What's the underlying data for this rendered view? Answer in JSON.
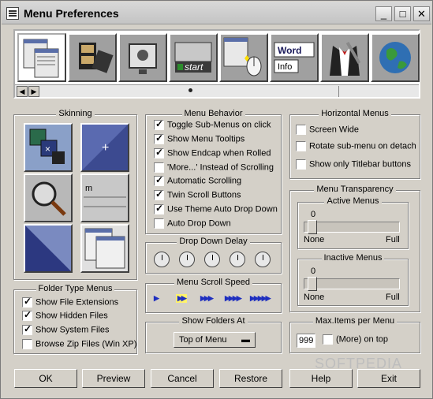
{
  "window": {
    "title": "Menu Preferences",
    "minimize": "_",
    "maximize": "□",
    "close": "✕"
  },
  "strip": {
    "tiles": [
      {
        "name": "menu-list-icon"
      },
      {
        "name": "film-icon"
      },
      {
        "name": "screen-icon"
      },
      {
        "name": "start-menu-icon",
        "label": "start"
      },
      {
        "name": "mouse-click-icon"
      },
      {
        "name": "word-info-icon",
        "label1": "Word",
        "label2": "Info"
      },
      {
        "name": "tuxedo-icon"
      },
      {
        "name": "globe-icon"
      }
    ],
    "scroll_left": "◀",
    "scroll_right": "▶"
  },
  "skinning": {
    "title": "Skinning"
  },
  "folder_types": {
    "title": "Folder Type Menus",
    "items": [
      {
        "label": "Show File Extensions",
        "checked": true
      },
      {
        "label": "Show Hidden Files",
        "checked": true
      },
      {
        "label": "Show System Files",
        "checked": true
      },
      {
        "label": "Browse Zip Files (Win XP)",
        "checked": false
      }
    ]
  },
  "menu_behavior": {
    "title": "Menu Behavior",
    "items": [
      {
        "label": "Toggle Sub-Menus on click",
        "checked": true
      },
      {
        "label": "Show Menu Tooltips",
        "checked": true
      },
      {
        "label": "Show Endcap when Rolled",
        "checked": true
      },
      {
        "label": "'More...' Instead of Scrolling",
        "checked": false
      },
      {
        "label": "Automatic Scrolling",
        "checked": true
      },
      {
        "label": "Twin Scroll Buttons",
        "checked": true
      },
      {
        "label": "Use Theme Auto Drop Down",
        "checked": true
      },
      {
        "label": "Auto Drop Down",
        "checked": false
      }
    ]
  },
  "drop_down_delay": {
    "title": "Drop Down Delay"
  },
  "menu_scroll_speed": {
    "title": "Menu Scroll Speed",
    "arrows": [
      "▶",
      "▶▶",
      "▶▶▶",
      "▶▶▶▶",
      "▶▶▶▶▶"
    ]
  },
  "show_folders_at": {
    "title": "Show Folders At",
    "value": "Top of Menu"
  },
  "horizontal_menus": {
    "title": "Horizontal Menus",
    "items": [
      {
        "label": "Screen Wide",
        "checked": false
      },
      {
        "label": "Rotate sub-menu on detach",
        "checked": false
      },
      {
        "label": "Show only Titlebar buttons",
        "checked": false
      }
    ]
  },
  "menu_transparency": {
    "title": "Menu Transparency",
    "active": {
      "title": "Active Menus",
      "value": "0",
      "min": "None",
      "max": "Full",
      "level": 0
    },
    "inactive": {
      "title": "Inactive Menus",
      "value": "0",
      "min": "None",
      "max": "Full",
      "level": 0
    }
  },
  "max_items": {
    "title": "Max.Items per Menu",
    "value": "999",
    "more_label": "(More) on top",
    "more_checked": false
  },
  "buttons": {
    "ok": "OK",
    "preview": "Preview",
    "cancel": "Cancel",
    "restore": "Restore",
    "help": "Help",
    "exit": "Exit"
  },
  "watermark": "SOFTPEDIA"
}
